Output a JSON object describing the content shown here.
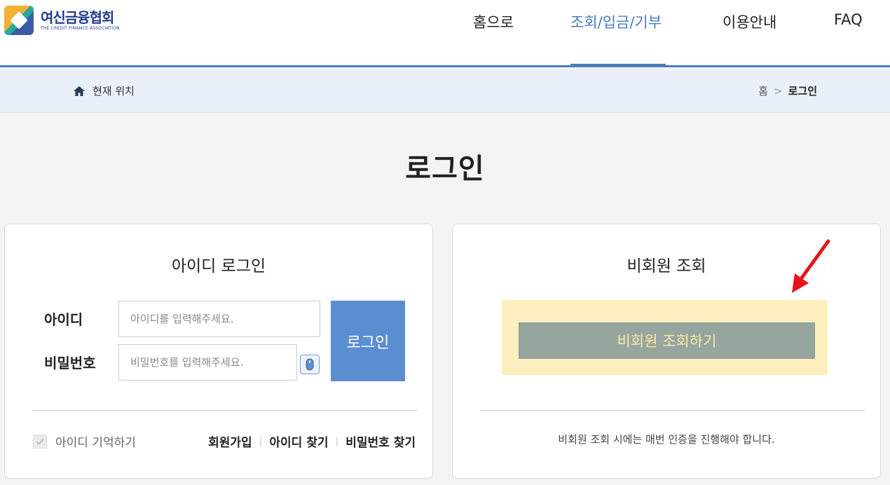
{
  "header": {
    "logo_kr": "여신금융협회",
    "logo_en": "THE CREDIT FINANCE ASSOCIATION",
    "nav": [
      {
        "label": "홈으로"
      },
      {
        "label": "조회/입금/기부"
      },
      {
        "label": "이용안내"
      },
      {
        "label": "FAQ"
      }
    ],
    "active_nav_index": 1
  },
  "breadcrumb": {
    "label": "현재 위치",
    "home": "홈",
    "separator": ">",
    "current": "로그인"
  },
  "page_title": "로그인",
  "id_login": {
    "title": "아이디 로그인",
    "id_label": "아이디",
    "id_placeholder": "아이디를 입력해주세요.",
    "pw_label": "비밀번호",
    "pw_placeholder": "비밀번호를 입력해주세요.",
    "login_button": "로그인",
    "remember_label": "아이디 기억하기",
    "remember_checked": true,
    "links": [
      "회원가입",
      "아이디 찾기",
      "비밀번호 찾기"
    ]
  },
  "guest": {
    "title": "비회원 조회",
    "button": "비회원 조회하기",
    "notice": "비회원 조회 시에는 매번 인증을 진행해야 합니다."
  },
  "colors": {
    "accent": "#4a7ec2",
    "login_button": "#5b8ed0",
    "guest_highlight": "#fdefbf",
    "guest_button": "#96a69e",
    "annotation_arrow": "#e8141b"
  }
}
